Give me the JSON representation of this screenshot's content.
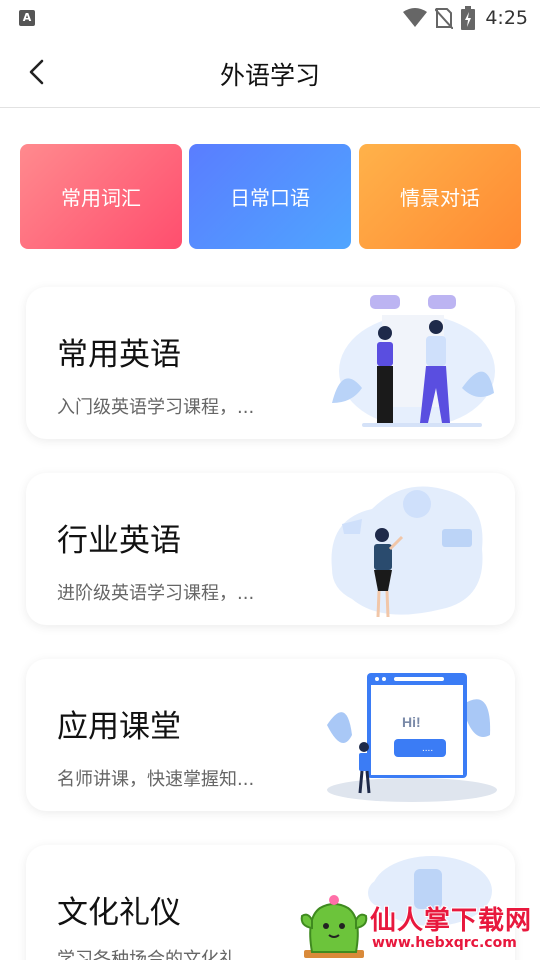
{
  "status_bar": {
    "app_icon_letter": "A",
    "time": "4:25"
  },
  "nav": {
    "title": "外语学习"
  },
  "quick_actions": [
    {
      "label": "常用词汇"
    },
    {
      "label": "日常口语"
    },
    {
      "label": "情景对话"
    }
  ],
  "courses": [
    {
      "title": "常用英语",
      "desc": "入门级英语学习课程，..."
    },
    {
      "title": "行业英语",
      "desc": "进阶级英语学习课程，..."
    },
    {
      "title": "应用课堂",
      "desc": "名师讲课，快速掌握知..."
    },
    {
      "title": "文化礼仪",
      "desc": "学习各种场合的文化礼..."
    }
  ],
  "illustration_text": {
    "chat_hi": "Hi!",
    "chat_dots": "...."
  },
  "watermark": {
    "title": "仙人掌下载网",
    "url": "www.hebxqrc.com"
  },
  "colors": {
    "quick_1": "#ff5a74",
    "quick_2": "#5a86ff",
    "quick_3": "#ff9a3c",
    "illus_blue": "#3b7cf5",
    "watermark_red": "#e8183d"
  }
}
